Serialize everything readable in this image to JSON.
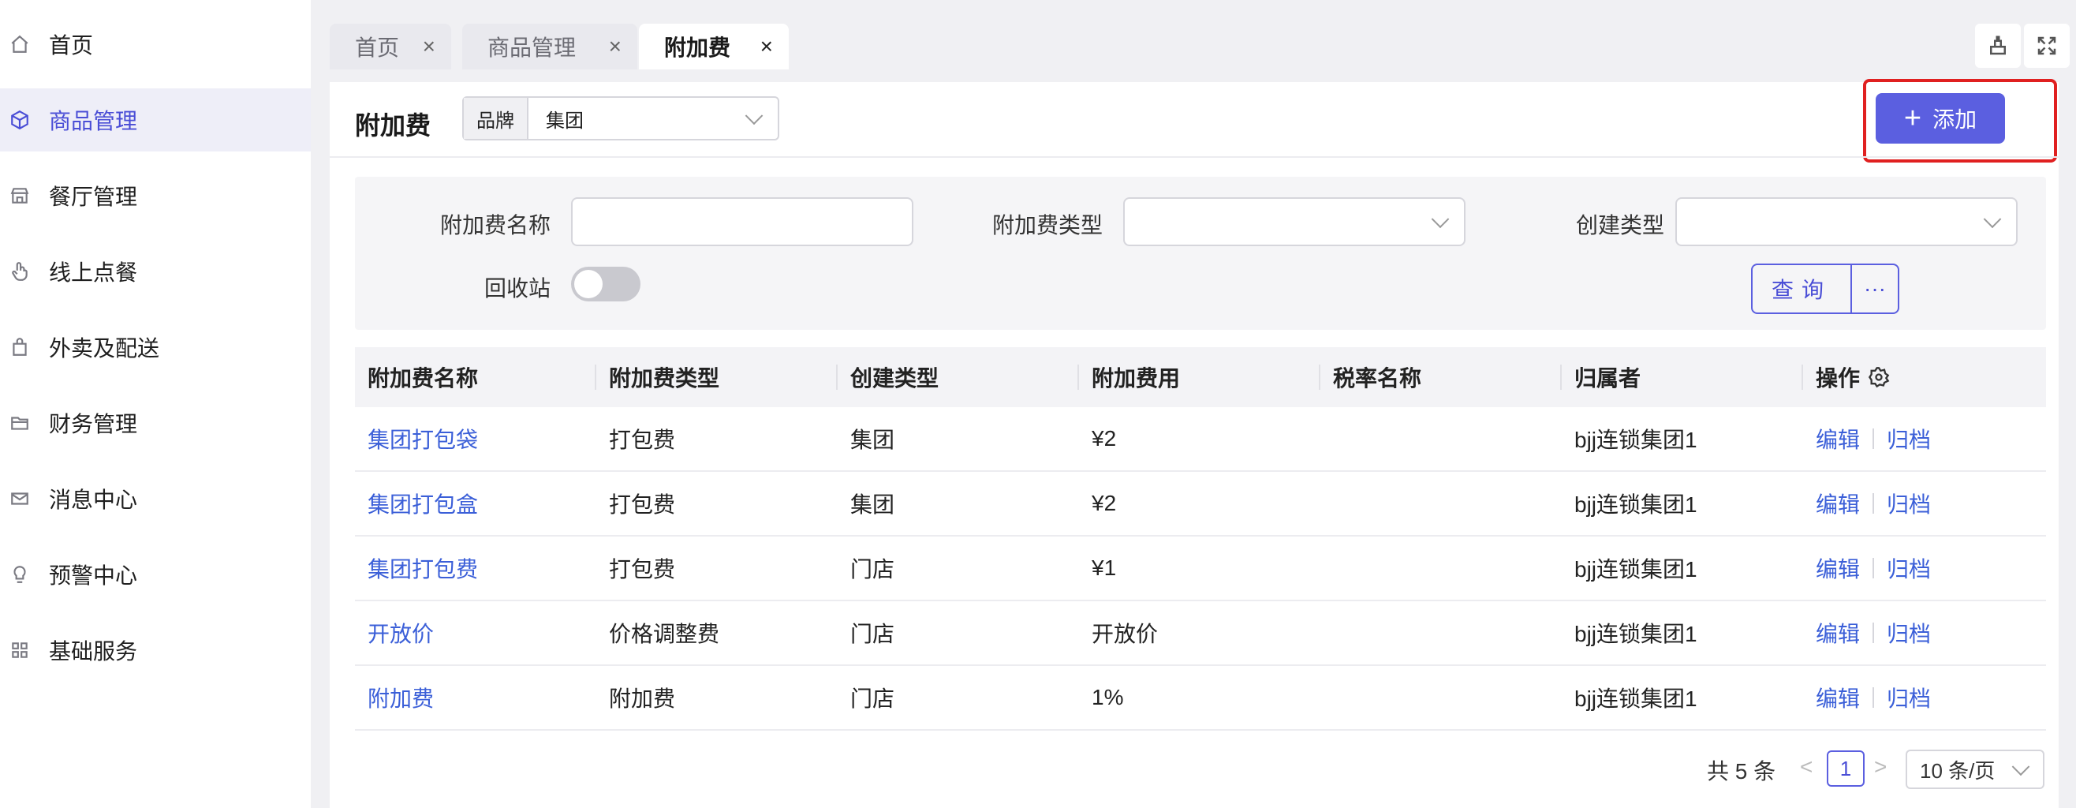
{
  "sidebar": {
    "items": [
      {
        "label": "首页",
        "icon": "home-icon"
      },
      {
        "label": "商品管理",
        "icon": "box-icon"
      },
      {
        "label": "餐厅管理",
        "icon": "store-icon"
      },
      {
        "label": "线上点餐",
        "icon": "hand-pointer-icon"
      },
      {
        "label": "外卖及配送",
        "icon": "bag-icon"
      },
      {
        "label": "财务管理",
        "icon": "folder-icon"
      },
      {
        "label": "消息中心",
        "icon": "mail-icon"
      },
      {
        "label": "预警中心",
        "icon": "bulb-icon"
      },
      {
        "label": "基础服务",
        "icon": "grid-icon"
      }
    ],
    "active_index": 1
  },
  "tabs": [
    {
      "label": "首页",
      "close": "×"
    },
    {
      "label": "商品管理",
      "close": "×"
    },
    {
      "label": "附加费",
      "close": "×"
    }
  ],
  "header": {
    "title": "附加费",
    "brand_prefix": "品牌",
    "brand_value": "集团",
    "add_label": "添加",
    "add_plus": "+"
  },
  "filter": {
    "name_label": "附加费名称",
    "type_label": "附加费类型",
    "create_label": "创建类型",
    "recycle_label": "回收站",
    "query_label": "查询",
    "more_label": "···"
  },
  "table": {
    "columns": [
      "附加费名称",
      "附加费类型",
      "创建类型",
      "附加费用",
      "税率名称",
      "归属者",
      "操作"
    ],
    "edit_label": "编辑",
    "archive_label": "归档",
    "rows": [
      {
        "name": "集团打包袋",
        "type": "打包费",
        "create": "集团",
        "fee": "¥2",
        "tax": "",
        "owner": "bjj连锁集团1"
      },
      {
        "name": "集团打包盒",
        "type": "打包费",
        "create": "集团",
        "fee": "¥2",
        "tax": "",
        "owner": "bjj连锁集团1"
      },
      {
        "name": "集团打包费",
        "type": "打包费",
        "create": "门店",
        "fee": "¥1",
        "tax": "",
        "owner": "bjj连锁集团1"
      },
      {
        "name": "开放价",
        "type": "价格调整费",
        "create": "门店",
        "fee": "开放价",
        "tax": "",
        "owner": "bjj连锁集团1"
      },
      {
        "name": "附加费",
        "type": "附加费",
        "create": "门店",
        "fee": "1%",
        "tax": "",
        "owner": "bjj连锁集团1"
      }
    ]
  },
  "pagination": {
    "total": "共 5 条",
    "prev": "<",
    "page": "1",
    "next": ">",
    "page_size": "10 条/页"
  },
  "colors": {
    "accent": "#5b5fe0",
    "link": "#3b5fd8",
    "highlight": "#e02020"
  }
}
